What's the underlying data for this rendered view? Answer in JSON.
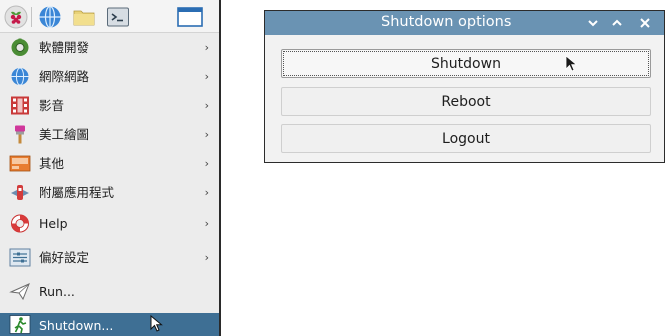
{
  "menu": {
    "items": [
      {
        "label": "軟體開發",
        "icon": "programming-icon",
        "has_submenu": true
      },
      {
        "label": "網際網路",
        "icon": "internet-globe-icon",
        "has_submenu": true
      },
      {
        "label": "影音",
        "icon": "sound-video-icon",
        "has_submenu": true
      },
      {
        "label": "美工繪圖",
        "icon": "graphics-brush-icon",
        "has_submenu": true
      },
      {
        "label": "其他",
        "icon": "other-icon",
        "has_submenu": true
      },
      {
        "label": "附屬應用程式",
        "icon": "accessories-icon",
        "has_submenu": true
      },
      {
        "label": "Help",
        "icon": "help-lifebuoy-icon",
        "has_submenu": true
      },
      {
        "label": "偏好設定",
        "icon": "preferences-icon",
        "has_submenu": true
      },
      {
        "label": "Run...",
        "icon": "run-paper-plane-icon",
        "has_submenu": false
      },
      {
        "label": "Shutdown...",
        "icon": "shutdown-exit-icon",
        "has_submenu": false,
        "highlighted": true
      }
    ],
    "submenu_arrow": "›"
  },
  "dialog": {
    "title": "Shutdown options",
    "buttons": {
      "shutdown": "Shutdown",
      "reboot": "Reboot",
      "logout": "Logout"
    },
    "titlebar_controls": [
      "minimize-chevron-icon",
      "maximize-caret-icon",
      "close-x-icon"
    ]
  },
  "colors": {
    "menu_highlight": "#3e6f94",
    "titlebar": "#6a93b3",
    "raspberry": "#c51a4a",
    "globe": "#3a86d6"
  }
}
